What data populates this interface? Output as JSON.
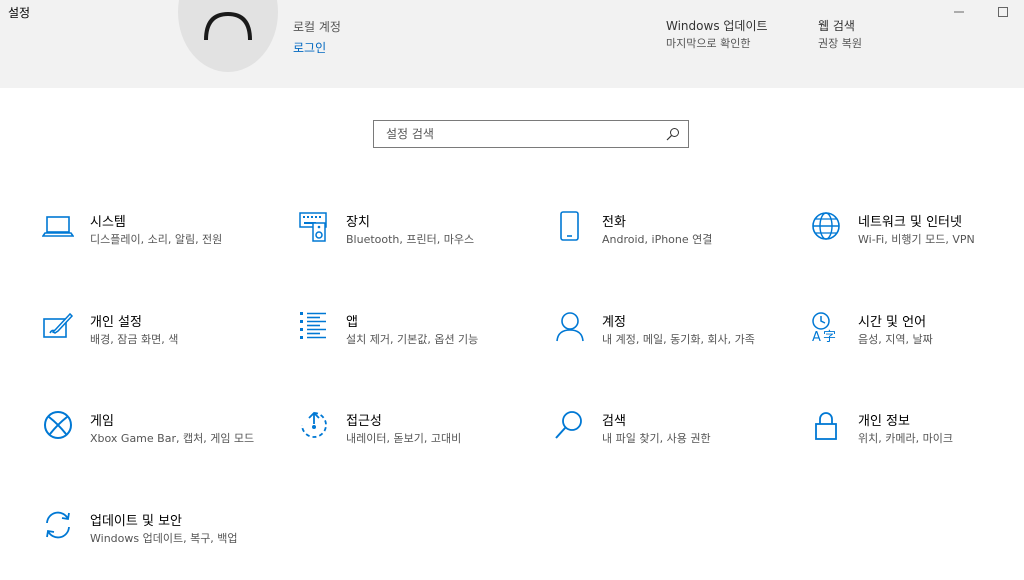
{
  "window": {
    "title": "설정"
  },
  "account": {
    "subtitle": "로컬 계정",
    "login_link": "로그인"
  },
  "header_items": [
    {
      "title": "Windows 업데이트",
      "desc": "마지막으로 확인한"
    },
    {
      "title": "웹 검색",
      "desc": "권장 복원"
    }
  ],
  "search": {
    "placeholder": "설정 검색"
  },
  "tiles": [
    {
      "icon": "laptop-icon",
      "label": "시스템",
      "desc": "디스플레이, 소리, 알림, 전원"
    },
    {
      "icon": "keyboard-speaker-icon",
      "label": "장치",
      "desc": "Bluetooth, 프린터, 마우스"
    },
    {
      "icon": "phone-icon",
      "label": "전화",
      "desc": "Android, iPhone 연결"
    },
    {
      "icon": "globe-icon",
      "label": "네트워크 및 인터넷",
      "desc": "Wi-Fi, 비행기 모드, VPN"
    },
    {
      "icon": "personalization-brush-icon",
      "label": "개인 설정",
      "desc": "배경, 잠금 화면, 색"
    },
    {
      "icon": "apps-list-icon",
      "label": "앱",
      "desc": "설치 제거, 기본값, 옵션 기능"
    },
    {
      "icon": "person-icon",
      "label": "계정",
      "desc": "내 계정, 메일, 동기화, 회사, 가족"
    },
    {
      "icon": "time-language-icon",
      "label": "시간 및 언어",
      "desc": "음성, 지역, 날짜"
    },
    {
      "icon": "xbox-icon",
      "label": "게임",
      "desc": "Xbox Game Bar, 캡처, 게임 모드"
    },
    {
      "icon": "ease-of-access-icon",
      "label": "접근성",
      "desc": "내레이터, 돋보기, 고대비"
    },
    {
      "icon": "search-icon",
      "label": "검색",
      "desc": "내 파일 찾기, 사용 권한"
    },
    {
      "icon": "lock-icon",
      "label": "개인 정보",
      "desc": "위치, 카메라, 마이크"
    },
    {
      "icon": "sync-update-icon",
      "label": "업데이트 및 보안",
      "desc": "Windows 업데이트, 복구, 백업"
    }
  ],
  "colors": {
    "accent": "#0067c0",
    "icon": "#0078d4",
    "header_bg": "#f2f2f2"
  }
}
